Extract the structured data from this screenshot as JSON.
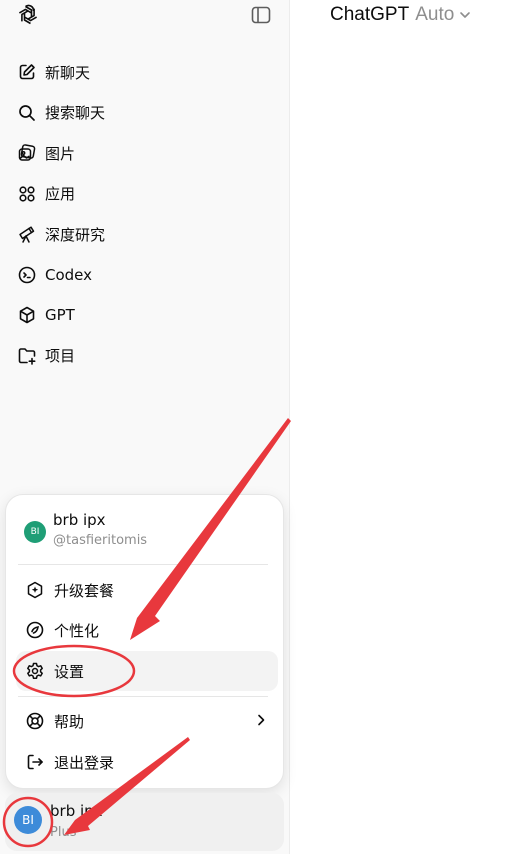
{
  "header": {
    "model_name": "ChatGPT",
    "model_variant": "Auto"
  },
  "sidebar": {
    "items": [
      {
        "label": "新聊天",
        "icon": "new-chat-icon"
      },
      {
        "label": "搜索聊天",
        "icon": "search-icon"
      },
      {
        "label": "图片",
        "icon": "images-icon"
      },
      {
        "label": "应用",
        "icon": "apps-icon"
      },
      {
        "label": "深度研究",
        "icon": "telescope-icon"
      },
      {
        "label": "Codex",
        "icon": "codex-icon"
      },
      {
        "label": "GPT",
        "icon": "cube-icon"
      },
      {
        "label": "项目",
        "icon": "folder-plus-icon"
      }
    ]
  },
  "menu": {
    "account": {
      "avatar_initials": "BI",
      "name": "brb ipx",
      "handle": "@tasfieritomis"
    },
    "items": [
      {
        "label": "升级套餐",
        "icon": "upgrade-icon"
      },
      {
        "label": "个性化",
        "icon": "personalize-icon"
      },
      {
        "label": "设置",
        "icon": "gear-icon"
      },
      {
        "label": "帮助",
        "icon": "help-icon"
      },
      {
        "label": "退出登录",
        "icon": "logout-icon"
      }
    ]
  },
  "user": {
    "avatar_initials": "BI",
    "name": "brb ipx",
    "plan": "Plus"
  },
  "colors": {
    "annotation": "#e8383d",
    "avatar_green": "#1f9e76",
    "avatar_blue": "#3d8bd9"
  }
}
